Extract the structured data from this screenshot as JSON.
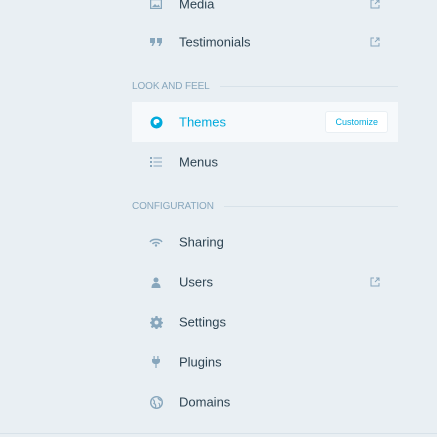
{
  "sidebar": {
    "top_item": {
      "label": "Media",
      "icon": "media-icon"
    },
    "testimonials": {
      "label": "Testimonials",
      "icon": "quote-icon"
    },
    "look_and_feel": {
      "title": "LOOK AND FEEL",
      "themes": {
        "label": "Themes",
        "icon": "themes-icon",
        "action": "Customize"
      },
      "menus": {
        "label": "Menus",
        "icon": "menus-icon"
      }
    },
    "configuration": {
      "title": "CONFIGURATION",
      "sharing": {
        "label": "Sharing",
        "icon": "sharing-icon"
      },
      "users": {
        "label": "Users",
        "icon": "user-icon"
      },
      "settings": {
        "label": "Settings",
        "icon": "cog-icon"
      },
      "plugins": {
        "label": "Plugins",
        "icon": "plug-icon"
      },
      "domains": {
        "label": "Domains",
        "icon": "globe-icon"
      }
    }
  },
  "colors": {
    "background": "#e9eff3",
    "selected_bg": "#f6f9fb",
    "accent": "#00aadc",
    "text": "#2e4453",
    "icon": "#87a6bc"
  }
}
